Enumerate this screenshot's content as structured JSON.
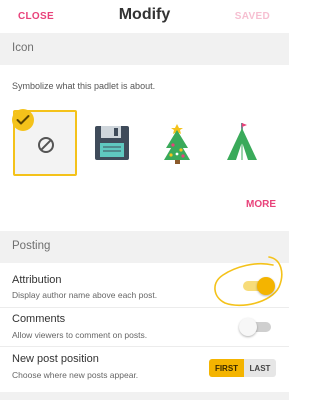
{
  "header": {
    "close": "CLOSE",
    "title": "Modify",
    "saved": "SAVED"
  },
  "icon_section": {
    "heading": "Icon",
    "description": "Symbolize what this padlet is about.",
    "options": [
      {
        "name": "none",
        "selected": true
      },
      {
        "name": "floppy-disk",
        "selected": false
      },
      {
        "name": "christmas-tree",
        "selected": false
      },
      {
        "name": "tent",
        "selected": false
      }
    ],
    "more": "MORE"
  },
  "posting": {
    "heading": "Posting",
    "attribution": {
      "title": "Attribution",
      "subtitle": "Display author name above each post.",
      "enabled": true
    },
    "comments": {
      "title": "Comments",
      "subtitle": "Allow viewers to comment on posts.",
      "enabled": false
    },
    "new_post_position": {
      "title": "New post position",
      "subtitle": "Choose where new posts appear.",
      "options": [
        "FIRST",
        "LAST"
      ],
      "selected": "FIRST"
    }
  },
  "colors": {
    "accent_pink": "#e8427a",
    "accent_yellow": "#f4b400",
    "section_bg": "#f1f1f1"
  }
}
